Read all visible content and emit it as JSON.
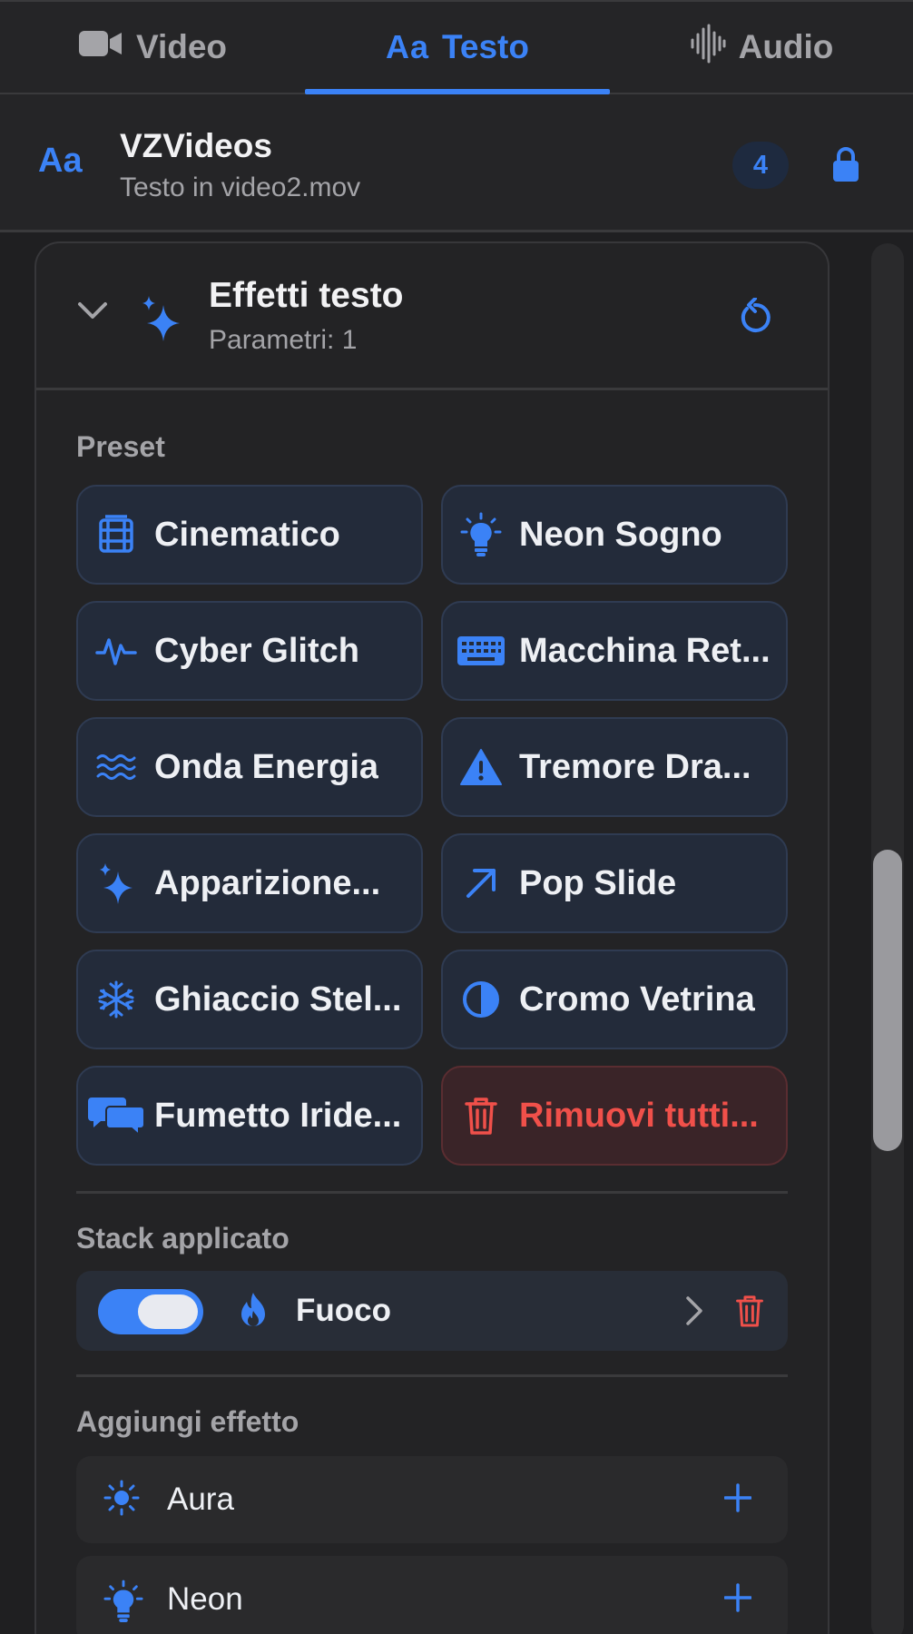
{
  "tabs": [
    {
      "label": "Video",
      "icon": "video-camera-icon"
    },
    {
      "label": "Testo",
      "icon_text": "Aa"
    },
    {
      "label": "Audio",
      "icon": "waveform-icon"
    }
  ],
  "header": {
    "icon_text": "Aa",
    "title": "VZVideos",
    "subtitle": "Testo in video2.mov",
    "badge": "4"
  },
  "panel": {
    "title": "Effetti testo",
    "subtitle": "Parametri: 1",
    "preset_label": "Preset",
    "presets": [
      {
        "label": "Cinematico",
        "icon": "film-icon"
      },
      {
        "label": "Neon Sogno",
        "icon": "lightbulb-icon"
      },
      {
        "label": "Cyber Glitch",
        "icon": "waveform-pulse-icon"
      },
      {
        "label": "Macchina Ret...",
        "icon": "keyboard-icon"
      },
      {
        "label": "Onda Energia",
        "icon": "waves-icon"
      },
      {
        "label": "Tremore Dra...",
        "icon": "warning-triangle-icon"
      },
      {
        "label": "Apparizione...",
        "icon": "sparkles-icon"
      },
      {
        "label": "Pop Slide",
        "icon": "arrow-up-right-icon"
      },
      {
        "label": "Ghiaccio Stel...",
        "icon": "snowflake-icon"
      },
      {
        "label": "Cromo Vetrina",
        "icon": "half-circle-icon"
      },
      {
        "label": "Fumetto Iride...",
        "icon": "speech-bubbles-icon"
      },
      {
        "label": "Rimuovi tutti...",
        "icon": "trash-icon"
      }
    ],
    "stack_label": "Stack applicato",
    "stack": [
      {
        "label": "Fuoco",
        "enabled": true,
        "icon": "flame-icon"
      }
    ],
    "add_label": "Aggiungi effetto",
    "add_effects": [
      {
        "label": "Aura",
        "icon": "sun-icon"
      },
      {
        "label": "Neon",
        "icon": "lightbulb-icon"
      }
    ]
  },
  "colors": {
    "accent": "#3b82f6",
    "danger": "#f0504a",
    "background": "#1f1f21"
  }
}
